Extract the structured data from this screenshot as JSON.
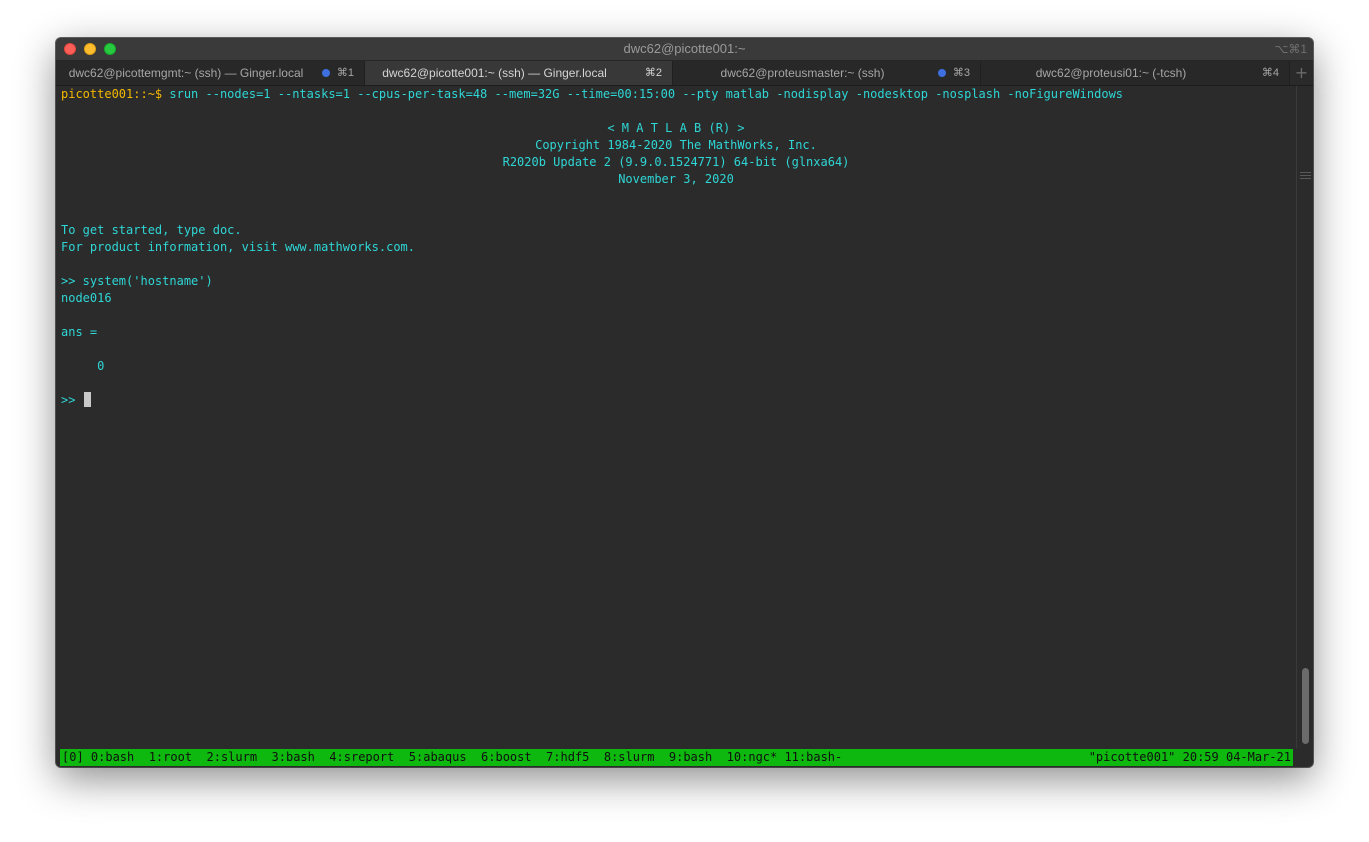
{
  "window": {
    "title": "dwc62@picotte001:~",
    "shortcut": "⌥⌘1"
  },
  "tabs": [
    {
      "label": "dwc62@picottemgmt:~ (ssh) — Ginger.local",
      "key": "⌘1",
      "active": false,
      "dot": true
    },
    {
      "label": "dwc62@picotte001:~ (ssh) — Ginger.local",
      "key": "⌘2",
      "active": true,
      "dot": false
    },
    {
      "label": "dwc62@proteusmaster:~ (ssh)",
      "key": "⌘3",
      "active": false,
      "dot": true
    },
    {
      "label": "dwc62@proteusi01:~ (-tcsh)",
      "key": "⌘4",
      "active": false,
      "dot": false
    }
  ],
  "tab_add_label": "+",
  "terminal": {
    "prompt": "picotte001::~$",
    "command": " srun --nodes=1 --ntasks=1 --cpus-per-task=48 --mem=32G --time=00:15:00 --pty matlab -nodisplay -nodesktop -nosplash -noFigureWindows",
    "banner": [
      "< M A T L A B (R) >",
      "Copyright 1984-2020 The MathWorks, Inc.",
      "R2020b Update 2 (9.9.0.1524771) 64-bit (glnxa64)",
      "November 3, 2020"
    ],
    "lines": [
      "To get started, type doc.",
      "For product information, visit www.mathworks.com.",
      "",
      ">> system('hostname')",
      "node016",
      "",
      "ans =",
      "",
      "     0",
      ""
    ],
    "current_prompt": ">> "
  },
  "statusbar": {
    "left": "[0] 0:bash  1:root  2:slurm  3:bash  4:sreport  5:abaqus  6:boost  7:hdf5  8:slurm  9:bash  10:ngc* 11:bash-",
    "right": "\"picotte001\" 20:59 04-Mar-21"
  },
  "colors": {
    "prompt": "#f5b900",
    "text": "#2fd6d6",
    "status_bg": "#0fb80f",
    "background": "#2b2b2b"
  }
}
